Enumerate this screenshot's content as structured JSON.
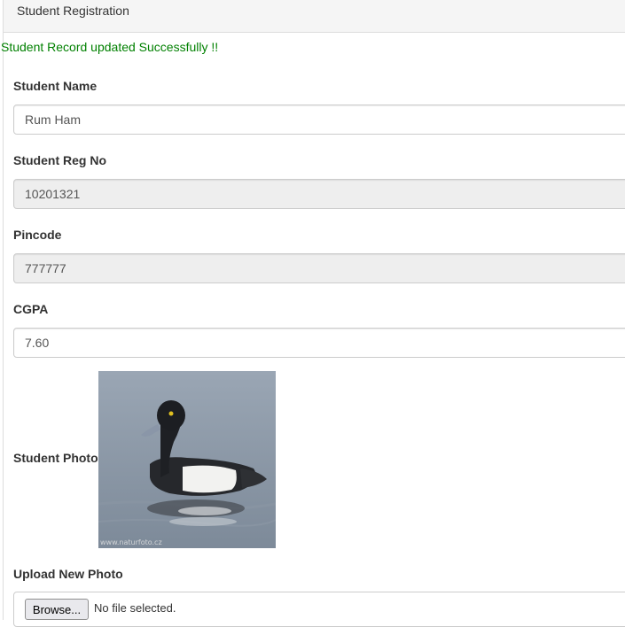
{
  "panel": {
    "title": "Student Registration"
  },
  "message": "Student Record updated Successfully !!",
  "fields": {
    "name": {
      "label": "Student Name",
      "value": "Rum Ham"
    },
    "reg_no": {
      "label": "Student Reg No",
      "value": "10201321"
    },
    "pincode": {
      "label": "Pincode",
      "value": "777777"
    },
    "cgpa": {
      "label": "CGPA",
      "value": "7.60"
    }
  },
  "photo": {
    "label": "Student Photo",
    "alt": "duck",
    "watermark": "www.naturfoto.cz"
  },
  "upload": {
    "label": "Upload New Photo",
    "button_label": "Browse...",
    "status": "No file selected."
  },
  "colors": {
    "success": "#008000",
    "readonly_bg": "#eeeeee",
    "heading_bg": "#f5f5f5"
  }
}
